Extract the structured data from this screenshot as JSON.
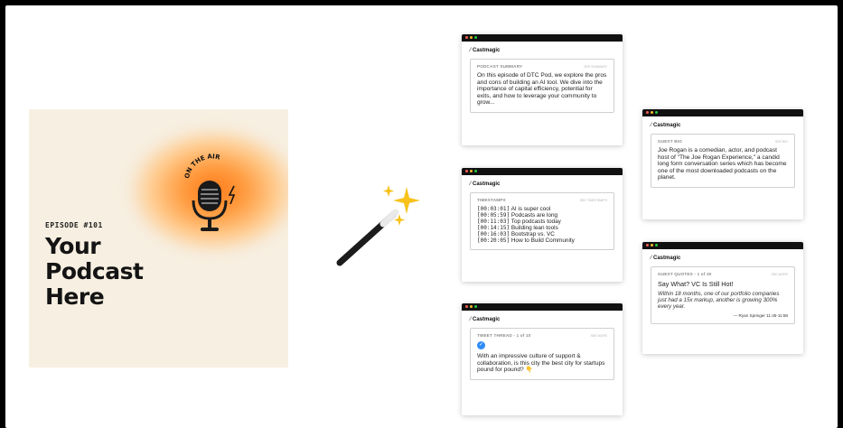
{
  "cover": {
    "badge": "ON THE AIR",
    "episode": "EPISODE #101",
    "title_lines": [
      "Your",
      "Podcast",
      "Here"
    ]
  },
  "brand_name": "Castmagic",
  "icons": [
    "microphone-icon",
    "lightning-icon",
    "magic-wand-icon",
    "sparkles-icon",
    "checkmark-icon"
  ],
  "colors": {
    "accent_orange": "#ff7a1a",
    "check_blue": "#2f8bf5",
    "window_bar": "#111111"
  },
  "windows": {
    "summary": {
      "label": "PODCAST SUMMARY",
      "meta": "SEE SUMMARY",
      "text": "On this episode of DTC Pod, we explore the pros and cons of building an AI tool. We dive into the importance of capital efficiency, potential for exits, and how to leverage your community to grow..."
    },
    "timestamps": {
      "label": "TIMESTAMPS",
      "meta": "SEE TIMESTAMPS",
      "items": [
        {
          "time": "[00:03:01]",
          "text": "AI is super cool"
        },
        {
          "time": "[00:05:59]",
          "text": "Podcasts are long"
        },
        {
          "time": "[00:11:03]",
          "text": "Top podcasts today"
        },
        {
          "time": "[00:14:15]",
          "text": "Building lean tools"
        },
        {
          "time": "[00:16:03]",
          "text": "Bootstrap vs. VC"
        },
        {
          "time": "[00:20:05]",
          "text": "How to Build Community"
        }
      ]
    },
    "tweet": {
      "label": "TWEET THREAD - 1 of 10",
      "meta": "SEE MORE",
      "text": "With an impressive culture of support & collaboration, is this city the best city for startups pound for pound? 👇"
    },
    "bio": {
      "label": "GUEST BIO",
      "meta": "SEE BIO",
      "text": "Joe Rogan is a comedian, actor, and podcast host of \"The Joe Rogan Experience,\" a candid long form conversation series which has become one of the most downloaded podcasts on the planet."
    },
    "quotes": {
      "label": "GUEST QUOTES - 1 of 30",
      "meta": "SEE MORE",
      "title": "Say What? VC Is Still Hot!",
      "quote": "Within 18 months, one of our portfolio companies just had a 15x markup, another is growing 300% every year.",
      "author": "— Ryan Springer 11:45-11:58"
    }
  }
}
